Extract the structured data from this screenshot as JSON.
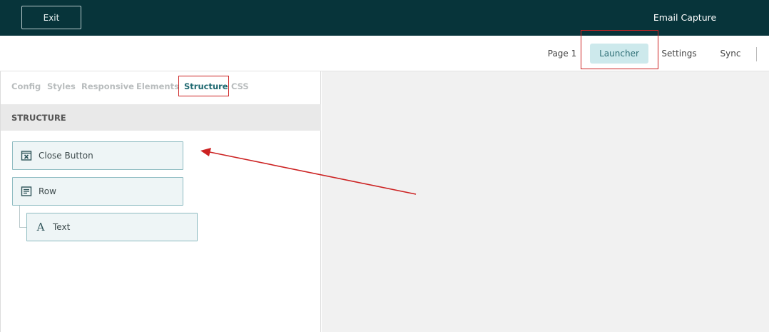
{
  "header": {
    "exit_label": "Exit",
    "app_title": "Email Capture"
  },
  "page_nav": {
    "items": [
      {
        "label": "Page 1"
      },
      {
        "label": "Launcher",
        "active": true
      },
      {
        "label": "Settings"
      },
      {
        "label": "Sync"
      }
    ]
  },
  "panel": {
    "tabs": [
      {
        "label": "Config"
      },
      {
        "label": "Styles"
      },
      {
        "label": "Responsive"
      },
      {
        "label": "Elements"
      },
      {
        "label": "Structure",
        "active": true
      },
      {
        "label": "CSS"
      }
    ],
    "section_title": "STRUCTURE",
    "tree": [
      {
        "label": "Close Button",
        "icon": "close-box-icon"
      },
      {
        "label": "Row",
        "icon": "row-icon"
      },
      {
        "label": "Text",
        "icon": "text-icon",
        "glyph": "A"
      }
    ]
  },
  "colors": {
    "topbar": "#07343a",
    "accent": "#1e6870",
    "active_nav_bg": "#cde9ec",
    "highlight": "#cc2222",
    "tree_item_bg": "#eef5f6",
    "tree_item_border": "#8fbcc2"
  }
}
